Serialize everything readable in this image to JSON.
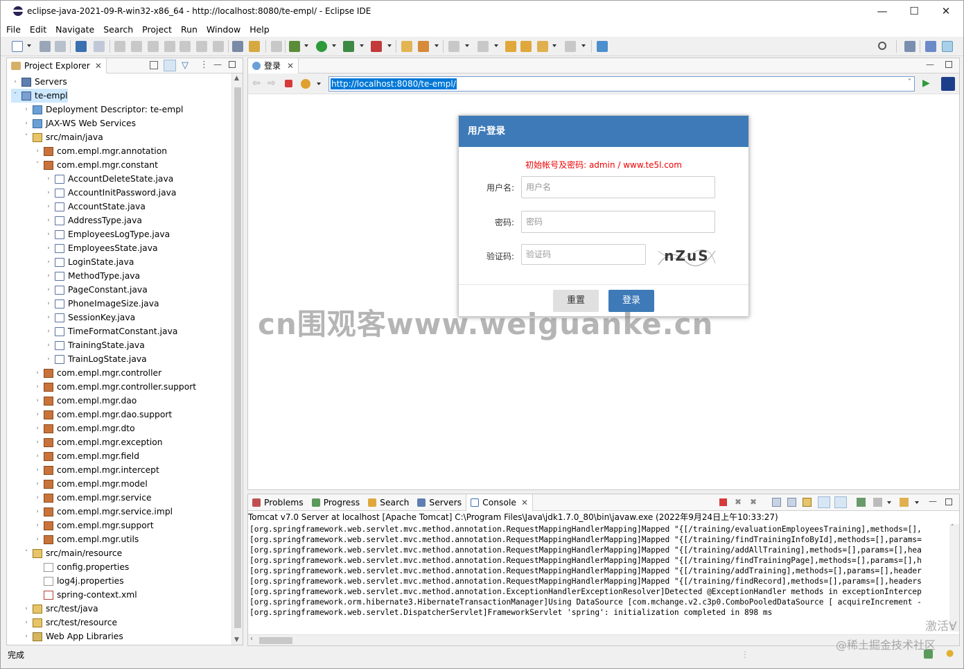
{
  "window": {
    "title": "eclipse-java-2021-09-R-win32-x86_64 - http://localhost:8080/te-empl/ - Eclipse IDE",
    "controls": {
      "minimize": "—",
      "maximize": "☐",
      "close": "✕"
    }
  },
  "menu": [
    "File",
    "Edit",
    "Navigate",
    "Search",
    "Project",
    "Run",
    "Window",
    "Help"
  ],
  "project_explorer": {
    "tab_label": "Project Explorer",
    "items": [
      {
        "label": "Servers",
        "indent": 0,
        "arrow": "›",
        "icon": "servers-folder-icon"
      },
      {
        "label": "te-empl",
        "indent": 0,
        "arrow": "˅",
        "icon": "project-icon",
        "selected": true
      },
      {
        "label": "Deployment Descriptor: te-empl",
        "indent": 1,
        "arrow": "›",
        "icon": "deployment-descriptor-icon"
      },
      {
        "label": "JAX-WS Web Services",
        "indent": 1,
        "arrow": "›",
        "icon": "web-services-icon"
      },
      {
        "label": "src/main/java",
        "indent": 1,
        "arrow": "˅",
        "icon": "source-folder-icon"
      },
      {
        "label": "com.empl.mgr.annotation",
        "indent": 2,
        "arrow": "›",
        "icon": "package-icon"
      },
      {
        "label": "com.empl.mgr.constant",
        "indent": 2,
        "arrow": "˅",
        "icon": "package-icon"
      },
      {
        "label": "AccountDeleteState.java",
        "indent": 3,
        "arrow": "›",
        "icon": "java-file-icon"
      },
      {
        "label": "AccountInitPassword.java",
        "indent": 3,
        "arrow": "›",
        "icon": "java-file-icon"
      },
      {
        "label": "AccountState.java",
        "indent": 3,
        "arrow": "›",
        "icon": "java-file-icon"
      },
      {
        "label": "AddressType.java",
        "indent": 3,
        "arrow": "›",
        "icon": "java-file-icon"
      },
      {
        "label": "EmployeesLogType.java",
        "indent": 3,
        "arrow": "›",
        "icon": "java-file-icon"
      },
      {
        "label": "EmployeesState.java",
        "indent": 3,
        "arrow": "›",
        "icon": "java-file-icon"
      },
      {
        "label": "LoginState.java",
        "indent": 3,
        "arrow": "›",
        "icon": "java-file-icon"
      },
      {
        "label": "MethodType.java",
        "indent": 3,
        "arrow": "›",
        "icon": "java-file-icon"
      },
      {
        "label": "PageConstant.java",
        "indent": 3,
        "arrow": "›",
        "icon": "java-file-icon"
      },
      {
        "label": "PhoneImageSize.java",
        "indent": 3,
        "arrow": "›",
        "icon": "java-file-icon"
      },
      {
        "label": "SessionKey.java",
        "indent": 3,
        "arrow": "›",
        "icon": "java-file-icon"
      },
      {
        "label": "TimeFormatConstant.java",
        "indent": 3,
        "arrow": "›",
        "icon": "java-file-icon"
      },
      {
        "label": "TrainingState.java",
        "indent": 3,
        "arrow": "›",
        "icon": "java-file-icon"
      },
      {
        "label": "TrainLogState.java",
        "indent": 3,
        "arrow": "›",
        "icon": "java-file-icon"
      },
      {
        "label": "com.empl.mgr.controller",
        "indent": 2,
        "arrow": "›",
        "icon": "package-icon"
      },
      {
        "label": "com.empl.mgr.controller.support",
        "indent": 2,
        "arrow": "›",
        "icon": "package-icon"
      },
      {
        "label": "com.empl.mgr.dao",
        "indent": 2,
        "arrow": "›",
        "icon": "package-icon"
      },
      {
        "label": "com.empl.mgr.dao.support",
        "indent": 2,
        "arrow": "›",
        "icon": "package-icon"
      },
      {
        "label": "com.empl.mgr.dto",
        "indent": 2,
        "arrow": "›",
        "icon": "package-icon"
      },
      {
        "label": "com.empl.mgr.exception",
        "indent": 2,
        "arrow": "›",
        "icon": "package-icon"
      },
      {
        "label": "com.empl.mgr.field",
        "indent": 2,
        "arrow": "›",
        "icon": "package-icon"
      },
      {
        "label": "com.empl.mgr.intercept",
        "indent": 2,
        "arrow": "›",
        "icon": "package-icon"
      },
      {
        "label": "com.empl.mgr.model",
        "indent": 2,
        "arrow": "›",
        "icon": "package-icon"
      },
      {
        "label": "com.empl.mgr.service",
        "indent": 2,
        "arrow": "›",
        "icon": "package-icon"
      },
      {
        "label": "com.empl.mgr.service.impl",
        "indent": 2,
        "arrow": "›",
        "icon": "package-icon"
      },
      {
        "label": "com.empl.mgr.support",
        "indent": 2,
        "arrow": "›",
        "icon": "package-icon"
      },
      {
        "label": "com.empl.mgr.utils",
        "indent": 2,
        "arrow": "›",
        "icon": "package-icon"
      },
      {
        "label": "src/main/resource",
        "indent": 1,
        "arrow": "˅",
        "icon": "source-folder-icon"
      },
      {
        "label": "config.properties",
        "indent": 2,
        "arrow": "",
        "icon": "properties-file-icon"
      },
      {
        "label": "log4j.properties",
        "indent": 2,
        "arrow": "",
        "icon": "properties-file-icon"
      },
      {
        "label": "spring-context.xml",
        "indent": 2,
        "arrow": "",
        "icon": "xml-file-icon"
      },
      {
        "label": "src/test/java",
        "indent": 1,
        "arrow": "›",
        "icon": "source-folder-icon"
      },
      {
        "label": "src/test/resource",
        "indent": 1,
        "arrow": "›",
        "icon": "source-folder-icon"
      },
      {
        "label": "Web App Libraries",
        "indent": 1,
        "arrow": "›",
        "icon": "library-icon"
      }
    ]
  },
  "browser": {
    "tab_label": "登录",
    "url": "http://localhost:8080/te-empl/",
    "login": {
      "header": "用户登录",
      "hint": "初始帐号及密码: admin  /  www.te5l.com",
      "username_label": "用户名:",
      "username_placeholder": "用户名",
      "password_label": "密码:",
      "password_placeholder": "密码",
      "captcha_label": "验证码:",
      "captcha_placeholder": "验证码",
      "captcha_text": "nZuS",
      "reset_button": "重置",
      "login_button": "登录"
    },
    "watermark": "cn围观客www.weiguanke.cn"
  },
  "console": {
    "tabs": [
      "Problems",
      "Progress",
      "Search",
      "Servers",
      "Console"
    ],
    "active_tab": "Console",
    "description": "Tomcat v7.0 Server at localhost [Apache Tomcat] C:\\Program Files\\Java\\jdk1.7.0_80\\bin\\javaw.exe  (2022年9月24日上午10:33:27)",
    "lines": [
      "[org.springframework.web.servlet.mvc.method.annotation.RequestMappingHandlerMapping]Mapped \"{[/training/evaluationEmployeesTraining],methods=[],",
      "[org.springframework.web.servlet.mvc.method.annotation.RequestMappingHandlerMapping]Mapped \"{[/training/findTrainingInfoById],methods=[],params=",
      "[org.springframework.web.servlet.mvc.method.annotation.RequestMappingHandlerMapping]Mapped \"{[/training/addAllTraining],methods=[],params=[],hea",
      "[org.springframework.web.servlet.mvc.method.annotation.RequestMappingHandlerMapping]Mapped \"{[/training/findTrainingPage],methods=[],params=[],h",
      "[org.springframework.web.servlet.mvc.method.annotation.RequestMappingHandlerMapping]Mapped \"{[/training/addTraining],methods=[],params=[],header",
      "[org.springframework.web.servlet.mvc.method.annotation.RequestMappingHandlerMapping]Mapped \"{[/training/findRecord],methods=[],params=[],headers",
      "[org.springframework.web.servlet.mvc.method.annotation.ExceptionHandlerExceptionResolver]Detected @ExceptionHandler methods in exceptionIntercep",
      "[org.springframework.orm.hibernate3.HibernateTransactionManager]Using DataSource [com.mchange.v2.c3p0.ComboPooledDataSource [ acquireIncrement -",
      "[org.springframework.web.servlet.DispatcherServlet]FrameworkServlet 'spring': initialization completed in 898 ms"
    ]
  },
  "status": {
    "text": "完成",
    "corner_text_1": "激活V",
    "corner_text_2": "@稀土掘金技术社区"
  },
  "colors": {
    "accent": "#3e7ab8",
    "login_button": "#3e7ab8",
    "hint_red": "#e00000",
    "selection": "#cde8ff",
    "url_selection": "#0078d7"
  }
}
